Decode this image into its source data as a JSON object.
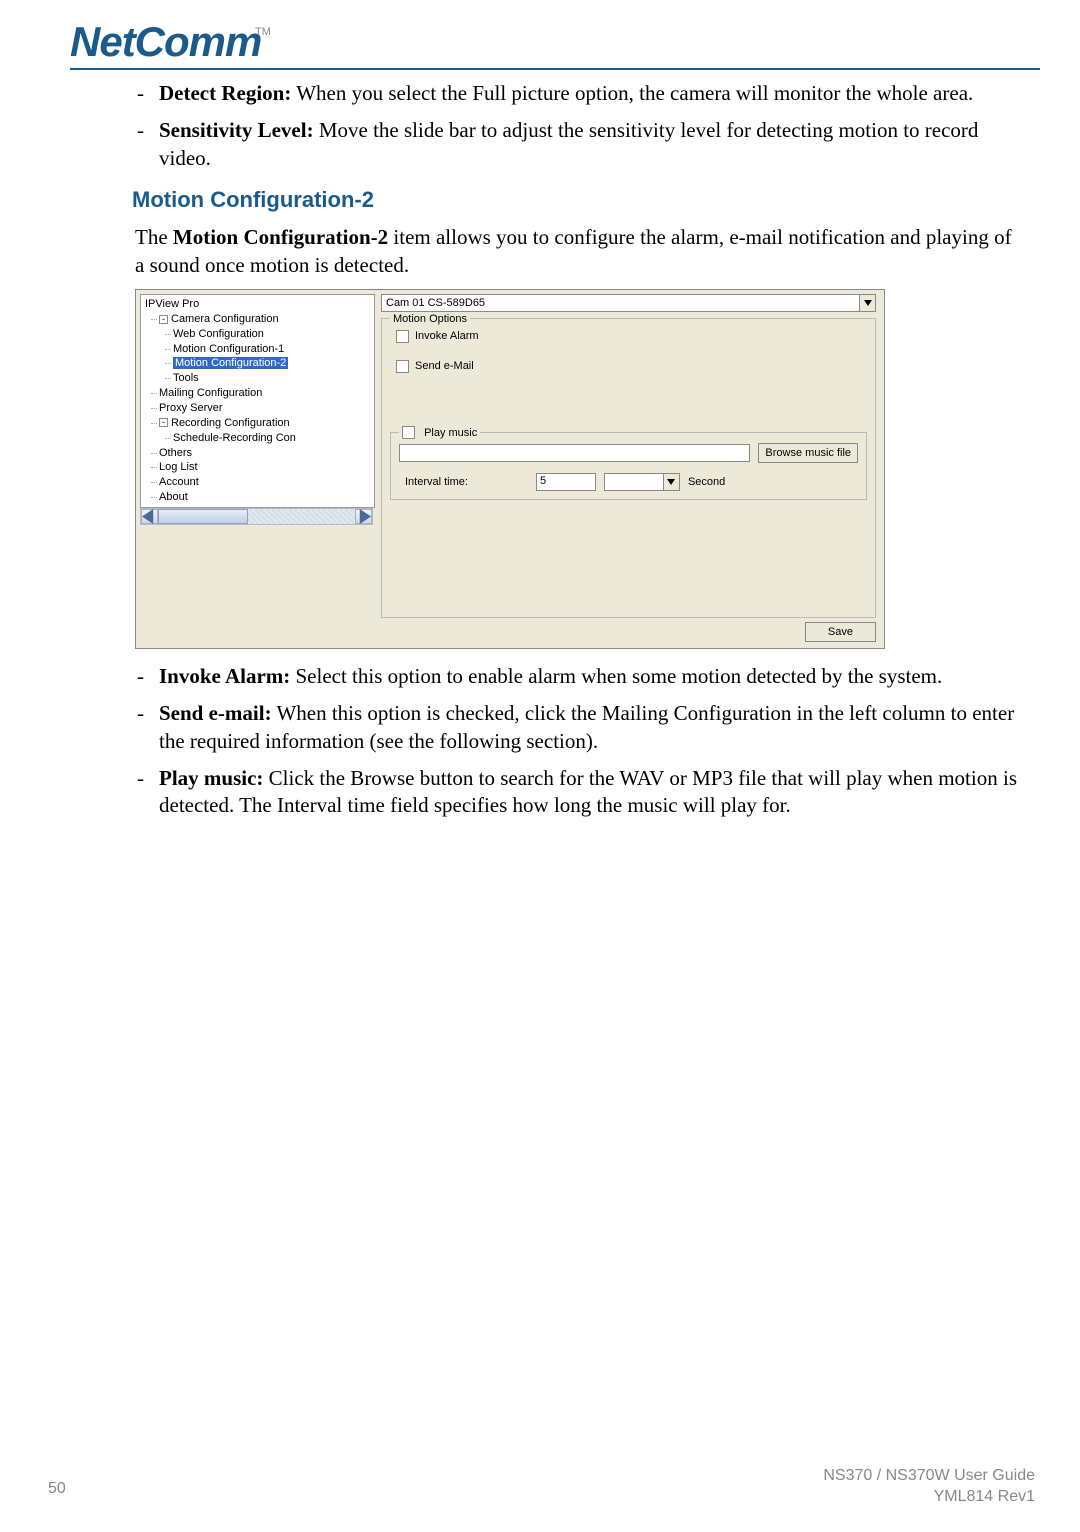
{
  "logo": {
    "text": "NetComm",
    "tm": "TM"
  },
  "bullets_top": [
    {
      "term": "Detect Region:",
      "text": " When you select the Full picture option, the camera will monitor the whole area."
    },
    {
      "term": "Sensitivity Level:",
      "text": " Move the slide bar to adjust the sensitivity level for detecting motion to record video."
    }
  ],
  "heading": "Motion Configuration-2",
  "intro_pre": "The ",
  "intro_bold": "Motion Configuration-2",
  "intro_post": " item allows you to configure the alarm, e-mail notification and playing of a sound once motion is detected.",
  "win": {
    "tree_root": "IPView Pro",
    "tree": {
      "camera_cfg": "Camera Configuration",
      "web_cfg": "Web Configuration",
      "mc1": "Motion Configuration-1",
      "mc2": "Motion Configuration-2",
      "tools": "Tools",
      "mail": "Mailing Configuration",
      "proxy": "Proxy Server",
      "rec_cfg": "Recording Configuration",
      "sched": "Schedule-Recording Con",
      "others": "Others",
      "loglist": "Log List",
      "account": "Account",
      "about": "About"
    },
    "cam_label": "Cam 01    CS-589D65",
    "group_title": "Motion Options",
    "invoke": "Invoke Alarm",
    "send": "Send e-Mail",
    "play_group": "Play music",
    "browse": "Browse music file",
    "interval_label": "Interval time:",
    "interval_value": "5",
    "second": "Second",
    "save": "Save"
  },
  "bullets_bottom": [
    {
      "term": "Invoke Alarm:",
      "text": " Select this option to enable alarm when some motion detected by the system."
    },
    {
      "term": "Send e-mail:",
      "text": " When this option is checked, click the Mailing Configuration in the left column to enter the required information (see the following section)."
    },
    {
      "term": "Play music:",
      "text": " Click the Browse button to search for the WAV or MP3 file that will play when motion is detected. The Interval time field specifies how long the music will play for."
    }
  ],
  "footer": {
    "page": "50",
    "guide": "NS370 / NS370W User Guide",
    "rev": "YML814 Rev1"
  }
}
